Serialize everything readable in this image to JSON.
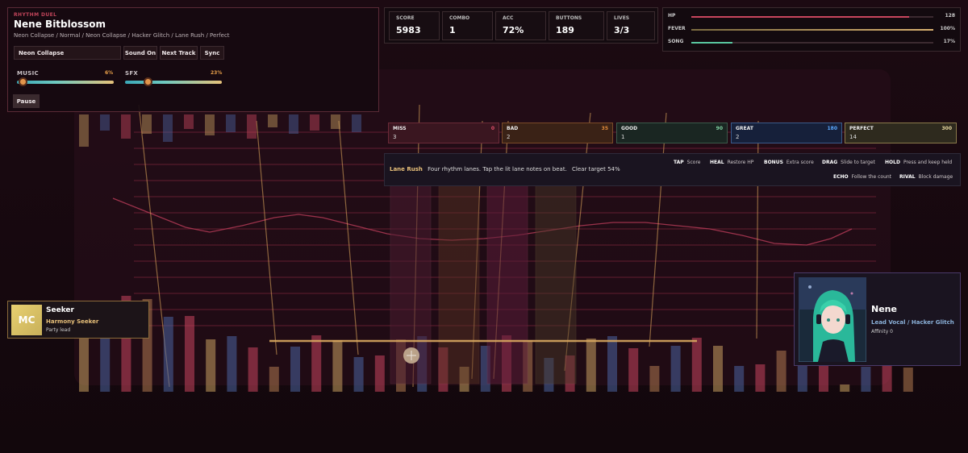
{
  "header": {
    "eyebrow": "RHYTHM DUEL",
    "title": "Nene Bitblossom",
    "subtitle": "Neon Collapse / Normal / Neon Collapse / Hacker Glitch / Lane Rush / Perfect"
  },
  "controls": {
    "track_name": "Neon Collapse",
    "sound_label": "Sound On",
    "next_label": "Next Track",
    "sync_label": "Sync",
    "pause_label": "Pause",
    "music_label": "MUSIC",
    "music_value_text": "6%",
    "music_level": 0.06,
    "sfx_label": "SFX",
    "sfx_value_text": "23%",
    "sfx_level": 0.23
  },
  "stats": {
    "score_label": "SCORE",
    "score": "5983",
    "combo_label": "COMBO",
    "combo": "1",
    "acc_label": "ACC",
    "acc": "72%",
    "buttons_label": "BUTTONS",
    "buttons": "189",
    "lives_label": "LIVES",
    "lives": "3/3"
  },
  "meters": {
    "hp_label": "HP",
    "hp_value": "128",
    "hp_level": 0.9,
    "fever_label": "FEVER",
    "fever_value": "100%",
    "fever_level": 1.0,
    "song_label": "SONG",
    "song_value": "17%",
    "song_level": 0.17
  },
  "judgements": [
    {
      "label": "MISS",
      "points": "0",
      "count": "3",
      "color": "#e0506a"
    },
    {
      "label": "BAD",
      "points": "35",
      "count": "2",
      "color": "#e08a3a"
    },
    {
      "label": "GOOD",
      "points": "90",
      "count": "1",
      "color": "#7fd0a0"
    },
    {
      "label": "GREAT",
      "points": "180",
      "count": "2",
      "color": "#5aa8ff"
    },
    {
      "label": "PERFECT",
      "points": "300",
      "count": "14",
      "color": "#e8d9a0"
    }
  ],
  "mode": {
    "name": "Lane Rush",
    "description": "Four rhythm lanes. Tap the lit lane notes on beat.",
    "target": "Clear target 54%"
  },
  "legend": [
    {
      "key": "TAP",
      "desc": "Score"
    },
    {
      "key": "HEAL",
      "desc": "Restore HP"
    },
    {
      "key": "BONUS",
      "desc": "Extra score"
    },
    {
      "key": "DRAG",
      "desc": "Slide to target"
    },
    {
      "key": "HOLD",
      "desc": "Press and keep held"
    },
    {
      "key": "ECHO",
      "desc": "Follow the count"
    },
    {
      "key": "RIVAL",
      "desc": "Block damage"
    }
  ],
  "player": {
    "initials": "MC",
    "name": "Seeker",
    "role": "Harmony Seeker",
    "party": "Party lead"
  },
  "rival": {
    "name": "Nene",
    "role": "Lead Vocal / Hacker Glitch",
    "affinity": "Affinity 0"
  },
  "colors": {
    "accent_gold": "#e8c07a",
    "accent_pink": "#c8465e",
    "accent_blue": "#4b64a0"
  }
}
